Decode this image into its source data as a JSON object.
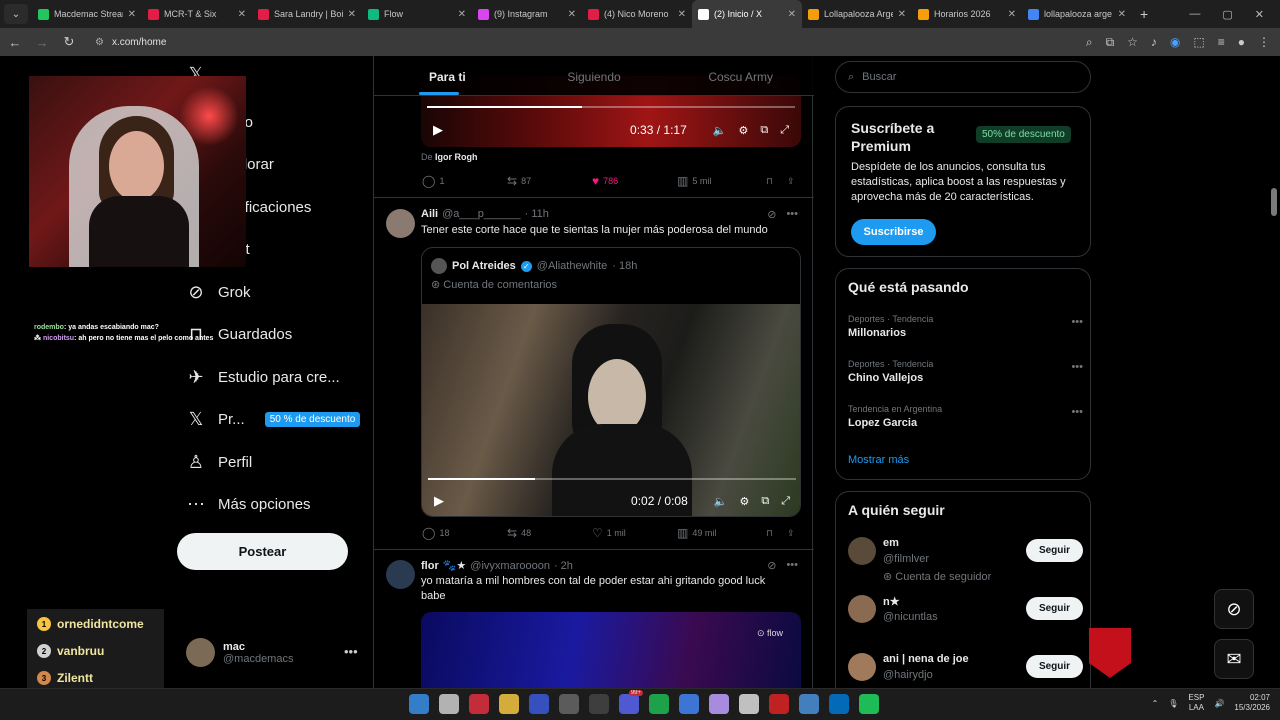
{
  "browser": {
    "tabs": [
      {
        "title": "Macdemac Stream",
        "color": "#22c55e",
        "active": false
      },
      {
        "title": "MCR-T & Six",
        "color": "#e11d48",
        "active": false
      },
      {
        "title": "Sara Landry | Boil",
        "color": "#e11d48",
        "active": false
      },
      {
        "title": "Flow",
        "color": "#10b981",
        "active": false
      },
      {
        "title": "(9) Instagram",
        "color": "#d946ef",
        "active": false
      },
      {
        "title": "(4) Nico Moreno",
        "color": "#e11d48",
        "active": false
      },
      {
        "title": "(2) Inicio / X",
        "color": "#ffffff",
        "active": true
      },
      {
        "title": "Lollapalooza Arge",
        "color": "#f59e0b",
        "active": false
      },
      {
        "title": "Horarios 2026",
        "color": "#f59e0b",
        "active": false
      },
      {
        "title": "lollapalooza arge",
        "color": "#4285f4",
        "active": false
      }
    ],
    "url": "x.com/home"
  },
  "stream": {
    "chat": [
      {
        "user": "rodembo",
        "text": ": ya andas escabiando mac?"
      },
      {
        "user": "nicobitsu",
        "text": ": ah pero no tiene mas el pelo como antes"
      }
    ],
    "ranks": [
      {
        "rank": "1",
        "name": "ornedidntcome",
        "color": "#f5c542"
      },
      {
        "rank": "2",
        "name": "vanbruu",
        "color": "#d0d0d0"
      },
      {
        "rank": "3",
        "name": "Zilentt",
        "color": "#d2884a"
      }
    ]
  },
  "nav": {
    "items": [
      {
        "label": "Inicio",
        "icon": "home-icon"
      },
      {
        "label": "Explorar",
        "icon": "search-icon"
      },
      {
        "label": "Notificaciones",
        "icon": "bell-icon"
      },
      {
        "label": "Chat",
        "icon": "chat-icon"
      },
      {
        "label": "Grok",
        "icon": "grok-icon"
      },
      {
        "label": "Guardados",
        "icon": "bookmark-icon"
      },
      {
        "label": "Estudio para cre...",
        "icon": "rocket-icon"
      },
      {
        "label": "Pr...",
        "icon": "x-logo-icon"
      },
      {
        "label": "Perfil",
        "icon": "person-icon"
      },
      {
        "label": "Más opciones",
        "icon": "more-circle-icon"
      }
    ],
    "premium_badge": "50 % de descuento",
    "post_button": "Postear",
    "account": {
      "name": "mac",
      "handle": "@macdemacs"
    }
  },
  "timeline": {
    "tabs": [
      "Para ti",
      "Siguiendo",
      "Coscu Army"
    ],
    "tweet0": {
      "video_time": "0:33 / 1:17",
      "progress": 0.42,
      "credit_prefix": "De",
      "credit_name": "Igor Rogh",
      "replies": "1",
      "reposts": "87",
      "likes": "786",
      "views": "5 mil"
    },
    "tweet1": {
      "name": "Aili",
      "handle": "@a___p______",
      "time": "· 11h",
      "text": "Tener este corte hace que te sientas la mujer más poderosa del mundo",
      "quote": {
        "name": "Pol Atreides",
        "handle": "@Aliathewhite",
        "time": "· 18h",
        "sub": "Cuenta de comentarios",
        "video_time": "0:02 / 0:08",
        "progress": 0.29
      },
      "replies": "18",
      "reposts": "48",
      "likes": "1 mil",
      "views": "49 mil"
    },
    "tweet2": {
      "name": "flor",
      "badges": "🐾★",
      "handle": "@ivyxmaroooon",
      "time": "· 2h",
      "text": "yo mataría a mil hombres con tal de poder estar ahi gritando good luck babe",
      "watermark": "flow"
    }
  },
  "right": {
    "search_placeholder": "Buscar",
    "premium": {
      "title": "Suscríbete a Premium",
      "badge": "50% de descuento",
      "text": "Despídete de los anuncios, consulta tus estadísticas, aplica boost a las respuestas y aprovecha más de 20 características.",
      "button": "Suscribirse"
    },
    "trends": {
      "title": "Qué está pasando",
      "items": [
        {
          "context": "Deportes · Tendencia",
          "name": "Millonarios"
        },
        {
          "context": "Deportes · Tendencia",
          "name": "Chino Vallejos"
        },
        {
          "context": "Tendencia en Argentina",
          "name": "Lopez Garcia"
        }
      ],
      "show_more": "Mostrar más"
    },
    "who_to_follow": {
      "title": "A quién seguir",
      "items": [
        {
          "name": "em",
          "handle": "@filmlver",
          "note": "Cuenta de seguidor",
          "avatar": "#5a4a3a"
        },
        {
          "name": "n★",
          "handle": "@nicuntlas",
          "note": "",
          "avatar": "#8a6a50"
        },
        {
          "name": "ani | nena de joe",
          "handle": "@hairydjo",
          "note": "",
          "avatar": "#a07a5a"
        }
      ],
      "follow_label": "Seguir"
    }
  },
  "taskbar": {
    "lang_1": "ESP",
    "lang_2": "LAA",
    "time": "02:07",
    "date": "15/3/2026",
    "badge": "99+"
  }
}
